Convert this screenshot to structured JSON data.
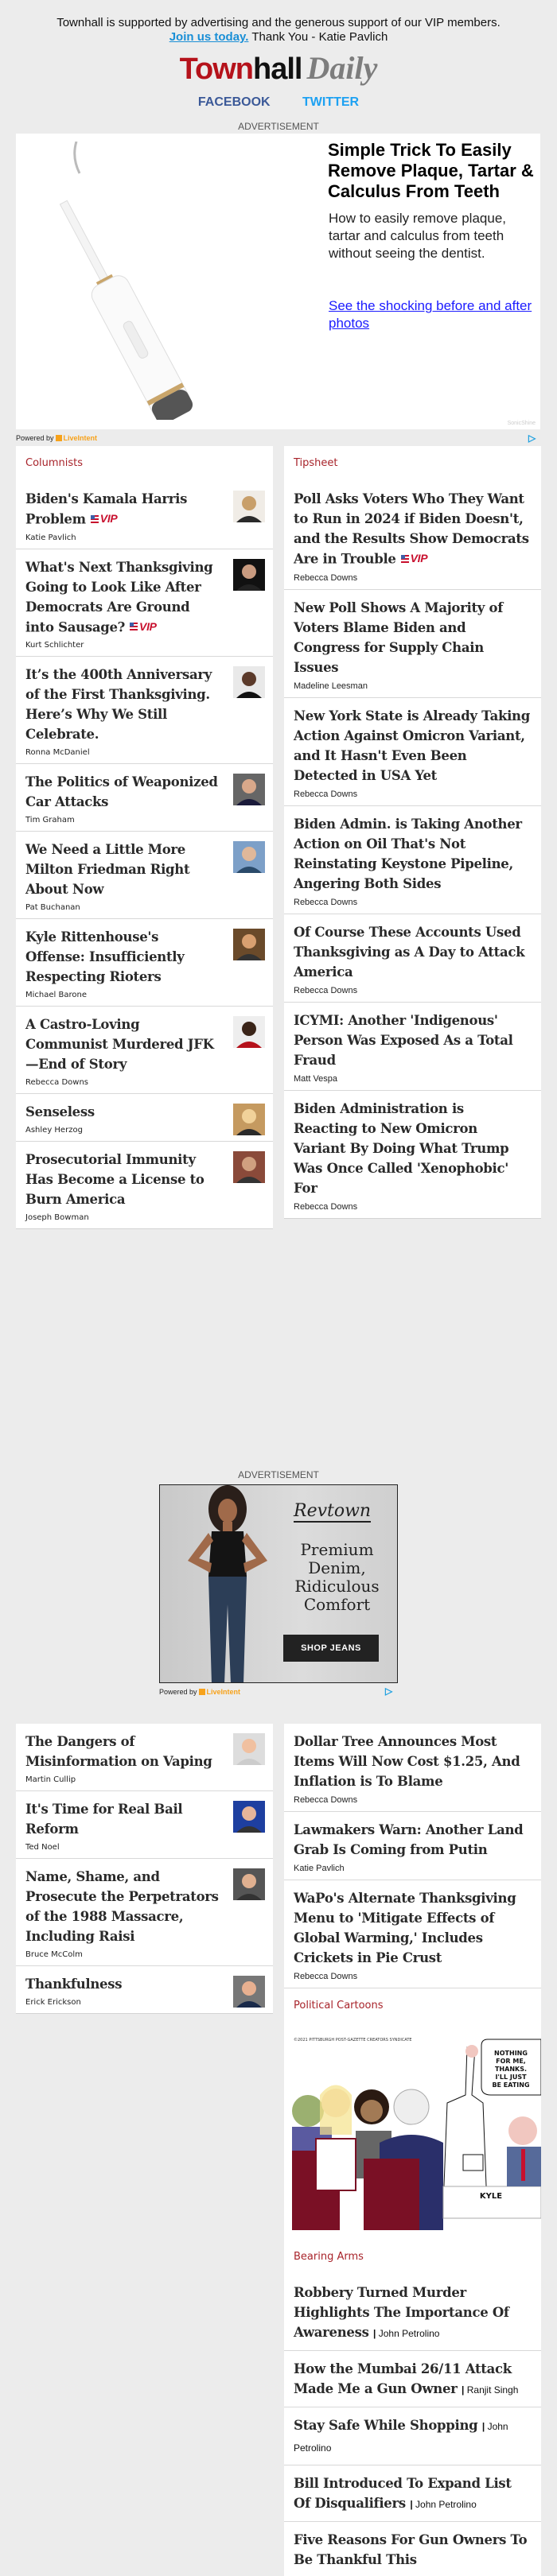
{
  "header": {
    "support_text": "Townhall is supported by advertising and the generous support of our VIP members.",
    "join_link": "Join us today.",
    "thanks_text": "Thank You - Katie Pavlich",
    "logo_town": "Town",
    "logo_hall": "hall",
    "logo_daily": "Daily",
    "social": {
      "facebook": "FACEBOOK",
      "twitter": "TWITTER"
    }
  },
  "ad_top": {
    "label": "ADVERTISEMENT",
    "headline": "Simple Trick To Easily Remove Plaque, Tartar & Calculus From Teeth",
    "body": "How to easily remove plaque, tartar and calculus from teeth without seeing the dentist.",
    "cta": "See the shocking before and after photos",
    "brand": "SonicShine",
    "powered_by": "Powered by",
    "provider": "LiveIntent"
  },
  "vip_label": "VIP",
  "columnists": {
    "label": "Columnists",
    "items": [
      {
        "title": "Biden's Kamala Harris Problem",
        "author": "Katie Pavlich",
        "vip": true
      },
      {
        "title": "What's Next Thanksgiving Going to Look Like After Democrats Are Ground into Sausage?",
        "author": "Kurt Schlichter",
        "vip": true
      },
      {
        "title": "It’s the 400th Anniversary of the First Thanksgiving. Here’s Why We Still Celebrate.",
        "author": "Ronna McDaniel",
        "vip": false
      },
      {
        "title": "The Politics of Weaponized Car Attacks",
        "author": "Tim Graham",
        "vip": false
      },
      {
        "title": "We Need a Little More Milton Friedman Right About Now",
        "author": "Pat Buchanan",
        "vip": false
      },
      {
        "title": "Kyle Rittenhouse's Offense: Insufficiently Respecting Rioters",
        "author": "Michael Barone",
        "vip": false
      },
      {
        "title": "A Castro-Loving Communist Murdered JFK—End of Story",
        "author": "Rebecca Downs",
        "vip": false
      },
      {
        "title": "Senseless",
        "author": "Ashley Herzog",
        "vip": false
      },
      {
        "title": "Prosecutorial Immunity Has Become a License to Burn America",
        "author": "Joseph Bowman",
        "vip": false
      }
    ]
  },
  "tipsheet": {
    "label": "Tipsheet",
    "items": [
      {
        "title": "Poll Asks Voters Who They Want to Run in 2024 if Biden Doesn't, and the Results Show Democrats Are in Trouble",
        "author": "Rebecca Downs",
        "vip": true
      },
      {
        "title": "New Poll Shows A Majority of Voters Blame Biden and Congress for Supply Chain Issues",
        "author": "Madeline Leesman",
        "vip": false
      },
      {
        "title": "New York State is Already Taking Action Against Omicron Variant, and It Hasn't Even Been Detected in USA Yet",
        "author": "Rebecca Downs",
        "vip": false
      },
      {
        "title": "Biden Admin. is Taking Another Action on Oil That's Not Reinstating Keystone Pipeline, Angering Both Sides",
        "author": "Rebecca Downs",
        "vip": false
      },
      {
        "title": "Of Course These Accounts Used Thanksgiving as A Day to Attack America",
        "author": "Rebecca Downs",
        "vip": false
      },
      {
        "title": "ICYMI: Another 'Indigenous' Person Was Exposed As a Total Fraud",
        "author": "Matt Vespa",
        "vip": false
      },
      {
        "title": "Biden Administration is Reacting to New Omicron Variant By Doing What Trump Was Once Called 'Xenophobic' For",
        "author": "Rebecca Downs",
        "vip": false
      }
    ]
  },
  "ad_mid": {
    "label": "ADVERTISEMENT",
    "brand": "Revtown",
    "tagline": "Premium Denim, Ridiculous Comfort",
    "cta": "SHOP JEANS",
    "powered_by": "Powered by",
    "provider": "LiveIntent"
  },
  "more_columnists": {
    "items": [
      {
        "title": "The Dangers of Misinformation on Vaping",
        "author": "Martin Cullip"
      },
      {
        "title": "It's Time for Real Bail Reform",
        "author": "Ted Noel"
      },
      {
        "title": "Name, Shame, and Prosecute the Perpetrators of the 1988 Massacre, Including Raisi",
        "author": "Bruce McColm"
      },
      {
        "title": "Thankfulness",
        "author": "Erick Erickson"
      }
    ]
  },
  "more_tipsheet": {
    "items": [
      {
        "title": "Dollar Tree Announces Most Items Will Now Cost $1.25, And Inflation is To Blame",
        "author": "Rebecca Downs"
      },
      {
        "title": "Lawmakers Warn: Another Land Grab Is Coming from Putin",
        "author": "Katie Pavlich"
      },
      {
        "title": "WaPo's Alternate Thanksgiving Menu to 'Mitigate Effects of Global Warming,' Includes Crickets in Pie Crust",
        "author": "Rebecca Downs"
      }
    ]
  },
  "political_cartoons": {
    "label": "Political Cartoons",
    "caption_bubble": "NOTHING FOR ME, THANKS. I'LL JUST BE EATING THEIR LUNCH",
    "table_card": "KYLE",
    "copyright": "©2021 PITTSBURGH POST-GAZETTE CREATORS SYNDICATE"
  },
  "bearing_arms": {
    "label": "Bearing Arms",
    "items": [
      {
        "title": "Robbery Turned Murder Highlights The Importance Of Awareness",
        "author": "John Petrolino"
      },
      {
        "title": "How the Mumbai 26/11 Attack Made Me a Gun Owner",
        "author": "Ranjit Singh"
      },
      {
        "title": "Stay Safe While Shopping",
        "author": "John Petrolino"
      },
      {
        "title": "Bill Introduced To Expand List Of Disqualifiers",
        "author": "John Petrolino"
      },
      {
        "title": "Five Reasons For Gun Owners To Be Thankful This",
        "author": ""
      }
    ]
  }
}
